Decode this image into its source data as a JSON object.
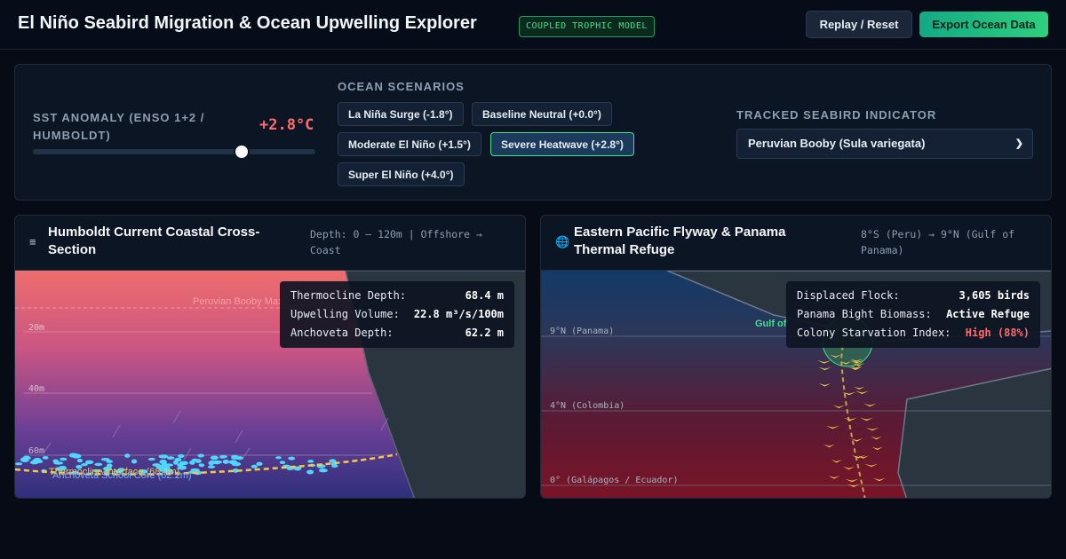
{
  "header": {
    "title": "El Niño Seabird Migration & Ocean Upwelling Explorer",
    "badge": "COUPLED TROPHIC MODEL",
    "replay_label": "Replay / Reset",
    "export_label": "Export Ocean Data"
  },
  "controls": {
    "sst_label": "SST ANOMALY (ENSO 1+2 / HUMBOLDT)",
    "sst_value": "+2.8°C",
    "sst_slider_level": 0.74,
    "scenarios_title": "OCEAN SCENARIOS",
    "scenarios": [
      {
        "label": "La Niña Surge (-1.8°)"
      },
      {
        "label": "Baseline Neutral (+0.0°)"
      },
      {
        "label": "Moderate El Niño (+1.5°)"
      },
      {
        "label": "Severe Heatwave (+2.8°)",
        "active": true
      },
      {
        "label": "Super El Niño (+4.0°)"
      }
    ],
    "indicator_title": "TRACKED SEABIRD INDICATOR",
    "indicator_selected": "Peruvian Booby (Sula variegata)"
  },
  "cross_section": {
    "title": "Humboldt Current Coastal Cross-Section",
    "meta": "Depth: 0 – 120m | Offshore → Coast",
    "icon": "layers-icon",
    "depth_labels": [
      "20m",
      "40m",
      "60m"
    ],
    "booby_label": "Peruvian Booby Max",
    "thermocline_label": "Thermocline Interface (68.4m)",
    "anchoveta_label": "Anchoveta School Core (62.2m)",
    "stats": [
      {
        "label": "Thermocline Depth:",
        "value": "68.4 m"
      },
      {
        "label": "Upwelling Volume:",
        "value": "22.8 m³/s/100m"
      },
      {
        "label": "Anchoveta Depth:",
        "value": "62.2 m"
      }
    ]
  },
  "flyway": {
    "title": "Eastern Pacific Flyway & Panama Thermal Refuge",
    "meta": "8°S (Peru) → 9°N (Gulf of Panama)",
    "icon": "globe-icon",
    "lat_labels": [
      "9°N (Panama)",
      "4°N (Colombia)",
      "0° (Galápagos / Ecuador)"
    ],
    "gulf_label": "Gulf of",
    "stats": [
      {
        "label": "Displaced Flock:",
        "value": "3,605 birds"
      },
      {
        "label": "Panama Bight Biomass:",
        "value": "Active Refuge"
      },
      {
        "label": "Colony Starvation Index:",
        "value": "High (88%)",
        "color": "#ff6b6b"
      }
    ]
  },
  "colors": {
    "accent": "#3ee08e",
    "warning": "#ff6b6b",
    "thermocline": "#f6c945",
    "anchoveta": "#4fd6ff"
  }
}
